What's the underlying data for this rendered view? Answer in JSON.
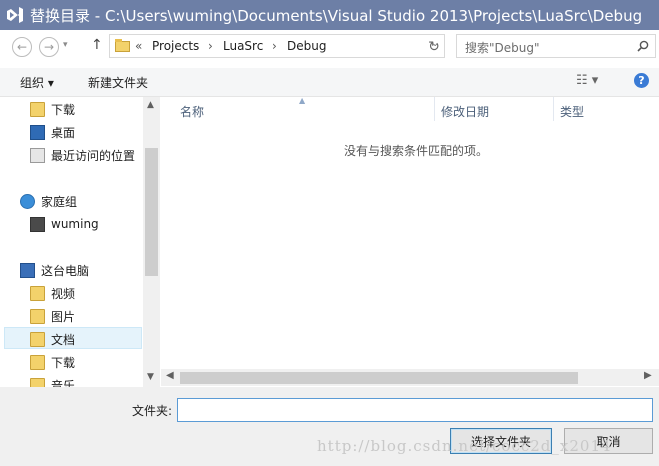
{
  "title": "替换目录 - C:\\Users\\wuming\\Documents\\Visual Studio 2013\\Projects\\LuaSrc\\Debug",
  "address": {
    "overflow": "«",
    "crumbs": [
      "Projects",
      "LuaSrc",
      "Debug"
    ],
    "separator": "›"
  },
  "search": {
    "placeholder": "搜索\"Debug\""
  },
  "toolbar": {
    "organize": "组织 ▾",
    "new_folder": "新建文件夹"
  },
  "nav": {
    "items": [
      {
        "label": "下载",
        "icon": "download-folder-icon"
      },
      {
        "label": "桌面",
        "icon": "desktop-icon"
      },
      {
        "label": "最近访问的位置",
        "icon": "recent-places-icon"
      },
      {
        "label": "家庭组",
        "icon": "homegroup-icon"
      },
      {
        "label": "wuming",
        "icon": "user-icon"
      },
      {
        "label": "这台电脑",
        "icon": "computer-icon"
      },
      {
        "label": "视频",
        "icon": "videos-folder-icon"
      },
      {
        "label": "图片",
        "icon": "pictures-folder-icon"
      },
      {
        "label": "文档",
        "icon": "documents-folder-icon"
      },
      {
        "label": "下载",
        "icon": "download-folder-icon"
      },
      {
        "label": "音乐",
        "icon": "music-folder-icon"
      }
    ]
  },
  "columns": [
    "名称",
    "修改日期",
    "类型"
  ],
  "empty_message": "没有与搜索条件匹配的项。",
  "footer": {
    "folder_label": "文件夹:",
    "folder_value": "",
    "select_button": "选择文件夹",
    "cancel_button": "取消"
  },
  "watermark": "http://blog.csdn.net/cocc2d_x2014"
}
